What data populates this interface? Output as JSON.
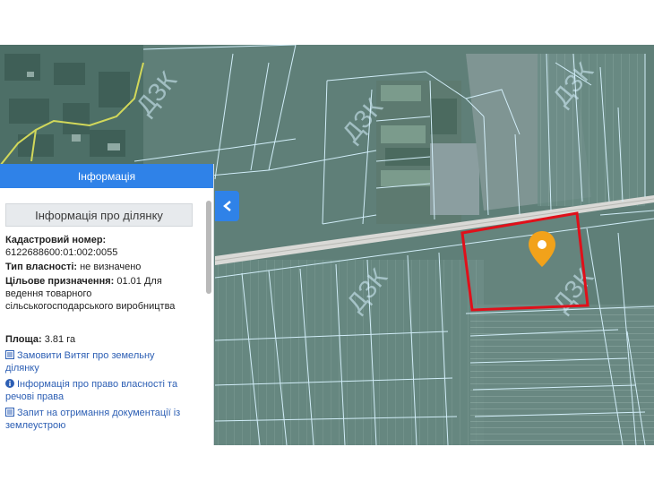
{
  "panel": {
    "header_title": "Інформація",
    "section_title": "Інформація про ділянку",
    "cadastral_label": "Кадастровий номер:",
    "cadastral_value": "6122688600:01:002:0055",
    "ownership_label": "Тип власності:",
    "ownership_value": "не визначено",
    "purpose_label": "Цільове призначення:",
    "purpose_value": "01.01 Для ведення товарного сільськогосподарського виробництва",
    "area_label": "Площа:",
    "area_value": "3.81 га",
    "links": [
      {
        "label": "Замовити Витяг про земельну ділянку",
        "icon": "document-list-icon"
      },
      {
        "label": "Інформація про право власності та речові права",
        "icon": "info-circle-icon"
      },
      {
        "label": "Запит на отримання документації із землеустрою",
        "icon": "document-list-icon"
      }
    ]
  },
  "map": {
    "watermark": "ДЗК",
    "colors": {
      "satellite_base": "#5f7f78",
      "parcel_lines": "#d7f3ff",
      "selected_parcel": "#e0101a",
      "marker": "#f2a21a",
      "panel_header": "#2f82e8"
    },
    "toggle_icon": "chevron-left-icon",
    "marker_icon": "map-pin-icon"
  }
}
